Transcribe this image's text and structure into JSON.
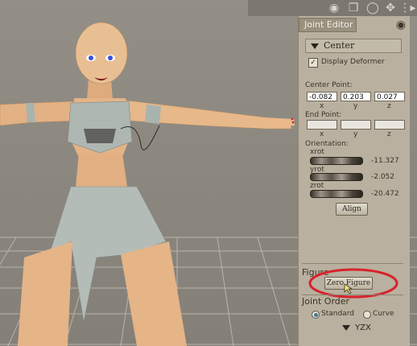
{
  "toolbar": {
    "icons": [
      "camera-icon",
      "copy-icon",
      "sphere-icon",
      "move-arrows-icon",
      "drag-grip-icon",
      "arrow-right-icon"
    ]
  },
  "panel": {
    "title": "Joint Editor",
    "center_section": "Center",
    "display_deformer_label": "Display Deformer",
    "display_deformer_checked": true,
    "center_point_label": "Center Point:",
    "center_point": {
      "x": "-0.082",
      "y": "0.203",
      "z": "0.027"
    },
    "axis_labels": {
      "x": "x",
      "y": "y",
      "z": "z"
    },
    "end_point_label": "End Point:",
    "end_point": {
      "x": "",
      "y": "",
      "z": ""
    },
    "orientation_label": "Orientation:",
    "xrot_label": "xrot",
    "xrot_value": "-11.327",
    "yrot_label": "yrot",
    "yrot_value": "-2.052",
    "zrot_label": "zrot",
    "zrot_value": "-20.472",
    "align_button": "Align",
    "figure_label": "Figure",
    "zero_figure_button": "Zero Figure",
    "joint_order_label": "Joint Order",
    "standard_label": "Standard",
    "curve_label": "Curve",
    "selected_order": "YZX"
  },
  "colors": {
    "panel": "#b9b0a0",
    "highlight_circle": "#d8222a",
    "skin": "#e7b98b",
    "hair_cap": "#e8c9a0"
  }
}
